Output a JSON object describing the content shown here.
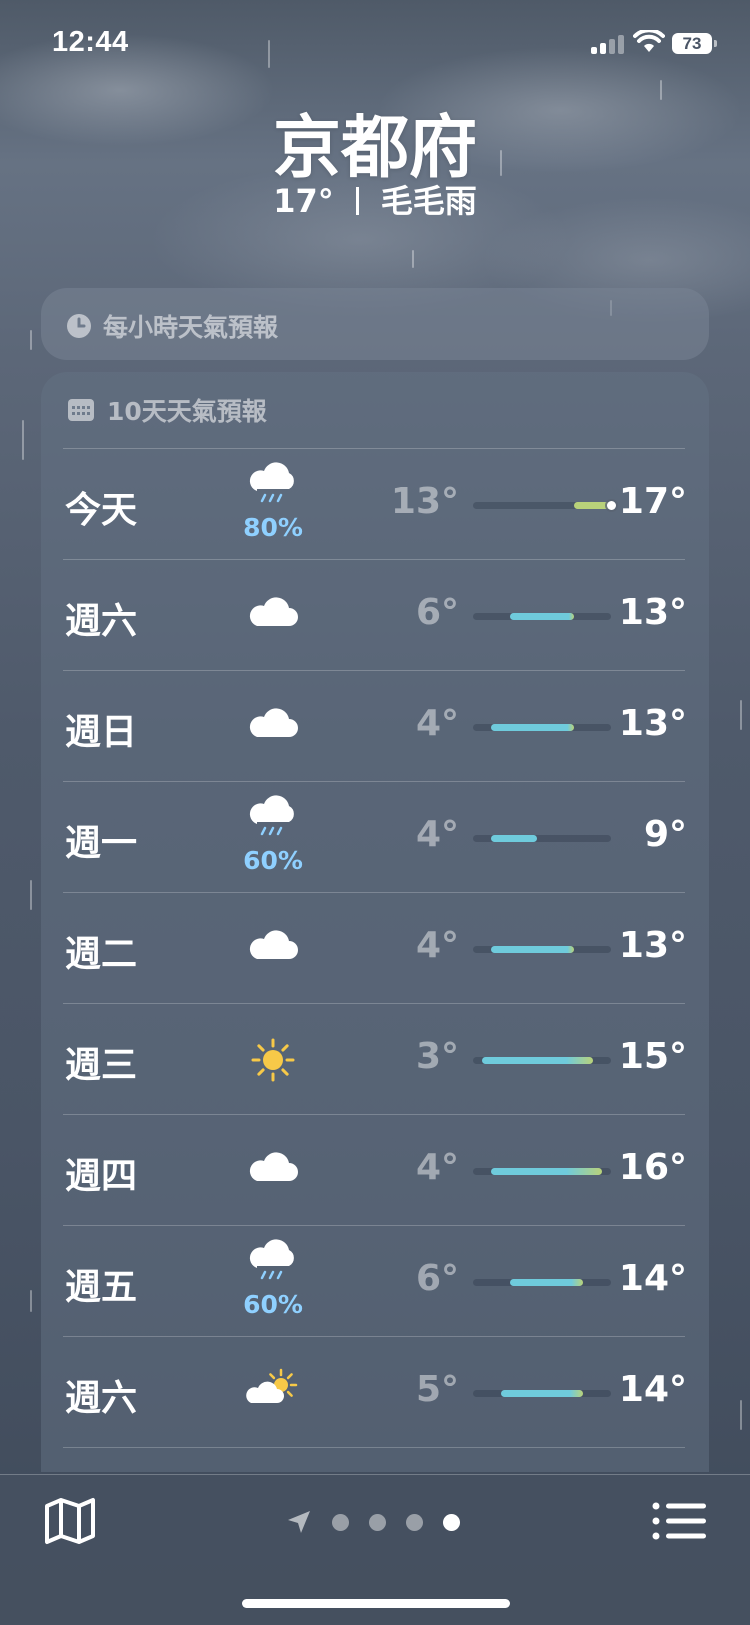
{
  "status_bar": {
    "time": "12:44",
    "battery": "73"
  },
  "header": {
    "city": "京都府",
    "temperature": "17°",
    "condition": "毛毛雨"
  },
  "hourly": {
    "title": "每小時天氣預報",
    "icon": "clock-icon"
  },
  "daily": {
    "title": "10天天氣預報",
    "icon": "calendar-icon",
    "days": [
      {
        "day": "今天",
        "icon": "rain-cloud",
        "precip": "80%",
        "low": "13°",
        "high": "17°",
        "low_val": 13,
        "high_val": 17,
        "current_val": 17
      },
      {
        "day": "週六",
        "icon": "cloud",
        "precip": "",
        "low": "6°",
        "high": "13°",
        "low_val": 6,
        "high_val": 13
      },
      {
        "day": "週日",
        "icon": "cloud",
        "precip": "",
        "low": "4°",
        "high": "13°",
        "low_val": 4,
        "high_val": 13
      },
      {
        "day": "週一",
        "icon": "rain-cloud",
        "precip": "60%",
        "low": "4°",
        "high": "9°",
        "low_val": 4,
        "high_val": 9
      },
      {
        "day": "週二",
        "icon": "cloud",
        "precip": "",
        "low": "4°",
        "high": "13°",
        "low_val": 4,
        "high_val": 13
      },
      {
        "day": "週三",
        "icon": "sun",
        "precip": "",
        "low": "3°",
        "high": "15°",
        "low_val": 3,
        "high_val": 15
      },
      {
        "day": "週四",
        "icon": "cloud",
        "precip": "",
        "low": "4°",
        "high": "16°",
        "low_val": 4,
        "high_val": 16
      },
      {
        "day": "週五",
        "icon": "rain-cloud",
        "precip": "60%",
        "low": "6°",
        "high": "14°",
        "low_val": 6,
        "high_val": 14
      },
      {
        "day": "週六",
        "icon": "partly-sunny",
        "precip": "",
        "low": "5°",
        "high": "14°",
        "low_val": 5,
        "high_val": 14
      }
    ],
    "range_min": 2,
    "range_max": 17
  },
  "colors": {
    "precip": "#8fd0ff",
    "bar_cool": "#6fcbdc",
    "bar_warm": "#b9d27a"
  },
  "toolbar": {
    "map": "map-icon",
    "location": "location-arrow-icon",
    "pages": 4,
    "active_page": 4,
    "list": "list-icon"
  }
}
